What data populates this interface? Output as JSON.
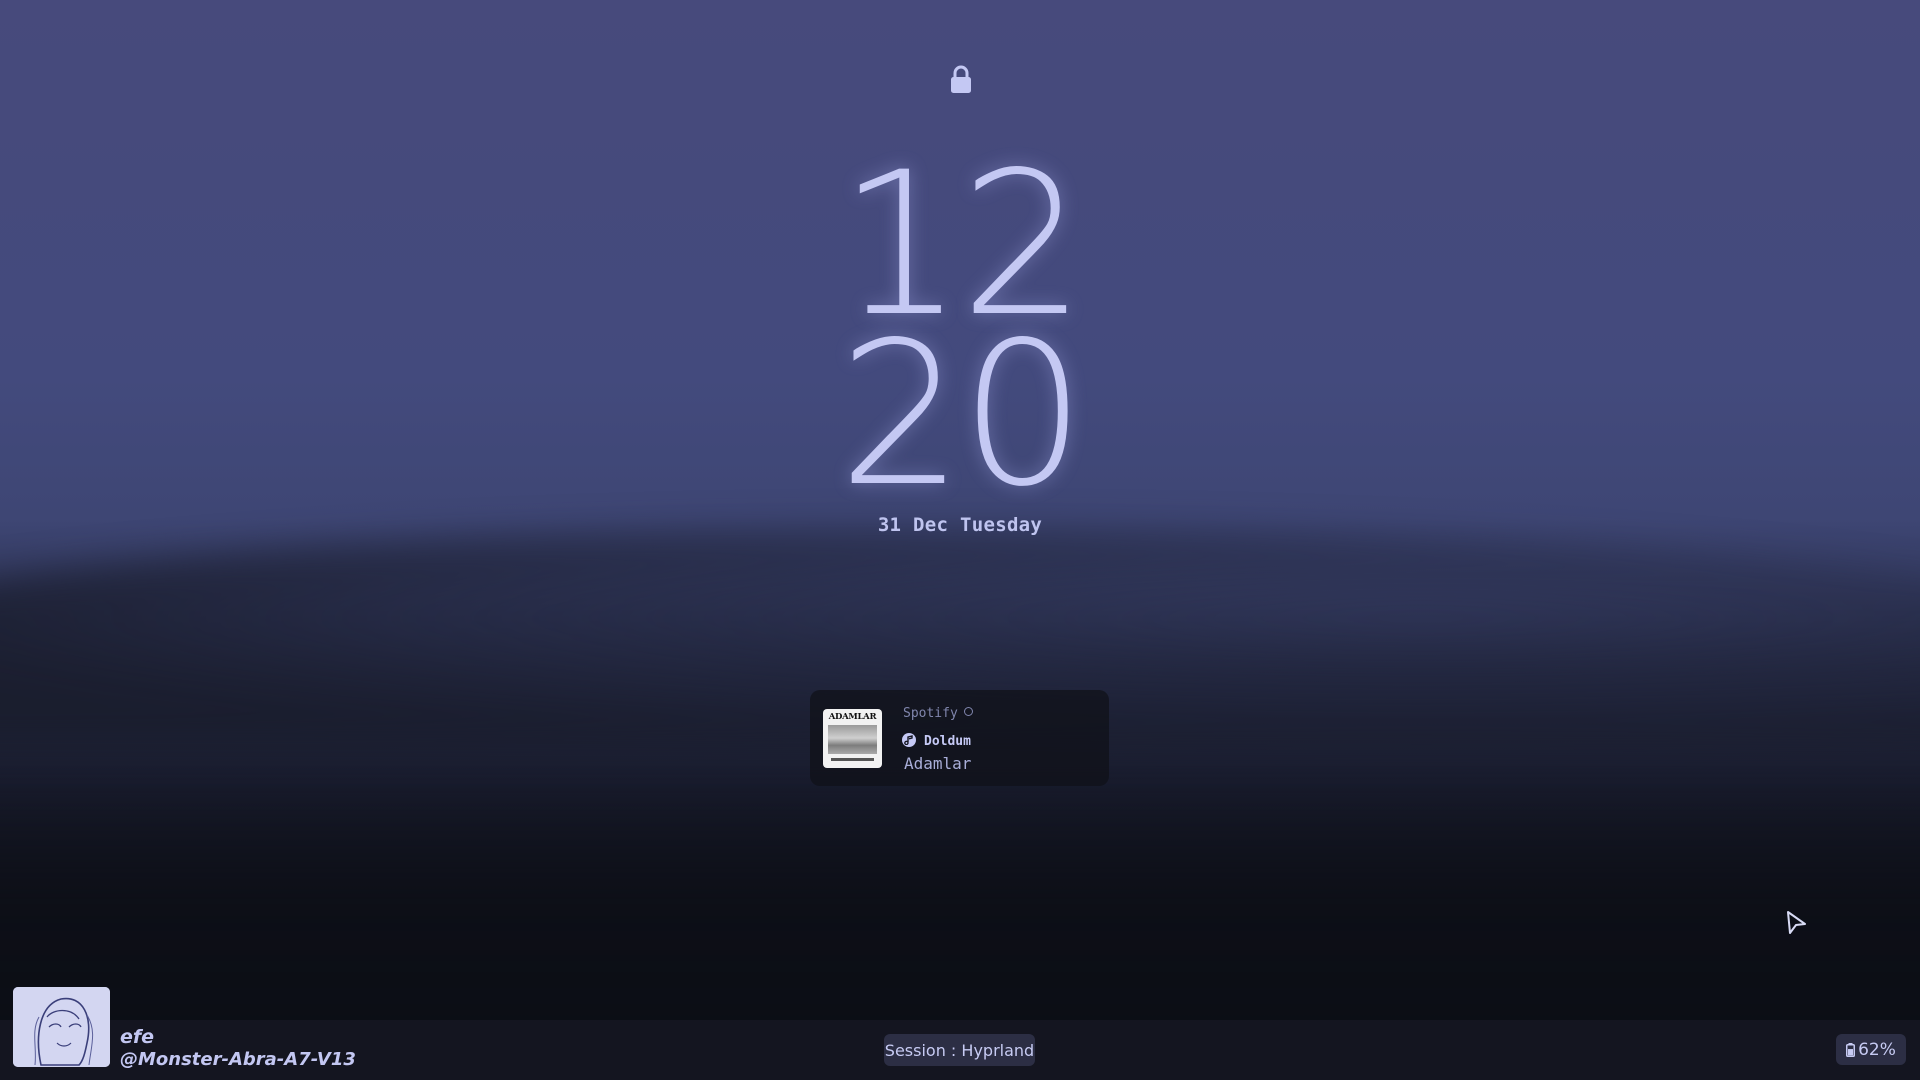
{
  "lockscreen": {
    "lock_icon": "lock-icon",
    "clock": {
      "hours": "12",
      "minutes": "20"
    },
    "date": "31 Dec Tuesday"
  },
  "media_player": {
    "source": "Spotify",
    "track_title": "Doldum",
    "artist": "Adamlar",
    "album_art_text": "ADAMLAR"
  },
  "user": {
    "name": "efe",
    "host": "@Monster-Abra-A7-V13"
  },
  "session": {
    "label": "Session : Hyprland"
  },
  "battery": {
    "percent_label": "62%",
    "level": 0.62
  },
  "colors": {
    "accent": "#c4c8f3",
    "background_top": "#474a7c",
    "background_bottom": "#0c0e15",
    "bar": "#141520",
    "pill": "#2c2e44"
  }
}
